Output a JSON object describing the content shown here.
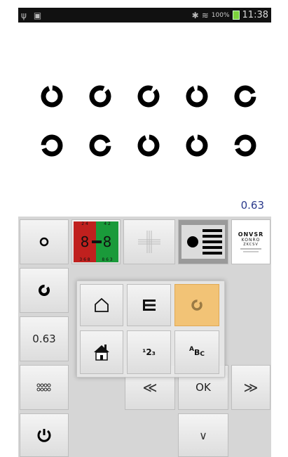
{
  "status_bar": {
    "battery": "100%",
    "time": "11:38"
  },
  "chart": {
    "acuity": "0.63",
    "rows": [
      [
        "open-top",
        "open-top-right",
        "open-top-right",
        "open-top",
        "open-right"
      ],
      [
        "open-left",
        "open-right",
        "open-top",
        "open-top",
        "open-left"
      ]
    ]
  },
  "test_tiles": {
    "red_green_left": "8",
    "red_green_right": "8",
    "letters_top": "ONVSR",
    "letters_line2": "KONRO",
    "letters_line3": "ZKCSV",
    "small_left": "2 4",
    "small_right": "4 2",
    "small_bl": "3 6 8",
    "small_br": "8 6 3"
  },
  "side": {
    "acuity_button": "0.63"
  },
  "nav": {
    "ok": "OK",
    "prev": "≪",
    "next": "≫",
    "down": "∨"
  },
  "popup": {
    "numbers": "¹2₃",
    "letters_a": "A",
    "letters_b": "B",
    "letters_c": "C"
  },
  "colors": {
    "selected": "#f2c376",
    "acuity_text": "#2b3a8c",
    "red": "#c0201e",
    "green": "#1a9a3a"
  }
}
